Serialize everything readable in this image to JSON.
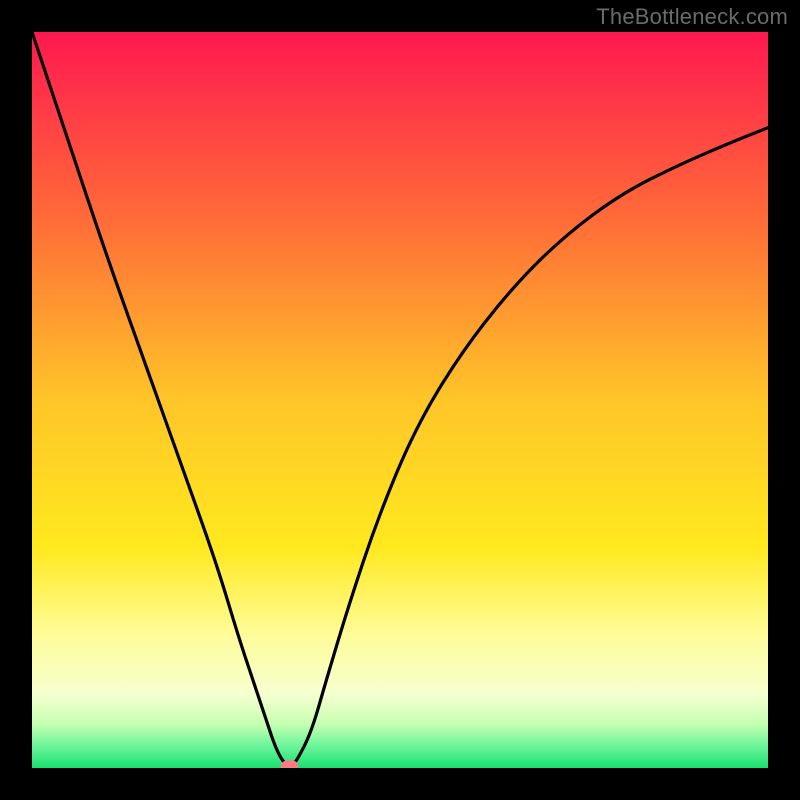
{
  "watermark": "TheBottleneck.com",
  "chart_data": {
    "type": "line",
    "title": "",
    "xlabel": "",
    "ylabel": "",
    "xlim": [
      0,
      100
    ],
    "ylim": [
      0,
      100
    ],
    "grid": false,
    "legend": false,
    "background_gradient": {
      "stops": [
        {
          "offset": 0.0,
          "color": "#ff1850"
        },
        {
          "offset": 0.25,
          "color": "#ff6a38"
        },
        {
          "offset": 0.5,
          "color": "#ffc528"
        },
        {
          "offset": 0.7,
          "color": "#ffe91e"
        },
        {
          "offset": 0.82,
          "color": "#fffc9a"
        },
        {
          "offset": 0.9,
          "color": "#f6ffd0"
        },
        {
          "offset": 0.94,
          "color": "#c6ffb2"
        },
        {
          "offset": 0.97,
          "color": "#6cf59a"
        },
        {
          "offset": 1.0,
          "color": "#19e06f"
        }
      ]
    },
    "series": [
      {
        "name": "curve",
        "x": [
          0,
          5,
          10,
          15,
          20,
          25,
          28,
          30,
          32,
          33,
          34,
          35,
          36,
          38,
          40,
          43,
          47,
          52,
          58,
          65,
          72,
          80,
          88,
          95,
          100
        ],
        "y": [
          100,
          85,
          70,
          56,
          42,
          28,
          18,
          12,
          6,
          3,
          1,
          0,
          1,
          5,
          12,
          22,
          34,
          46,
          56,
          65,
          72,
          78,
          82,
          85,
          87
        ]
      }
    ],
    "marker": {
      "name": "minimum-marker",
      "x": 35,
      "y": 0,
      "color": "#ff7a85"
    }
  },
  "icons": {}
}
